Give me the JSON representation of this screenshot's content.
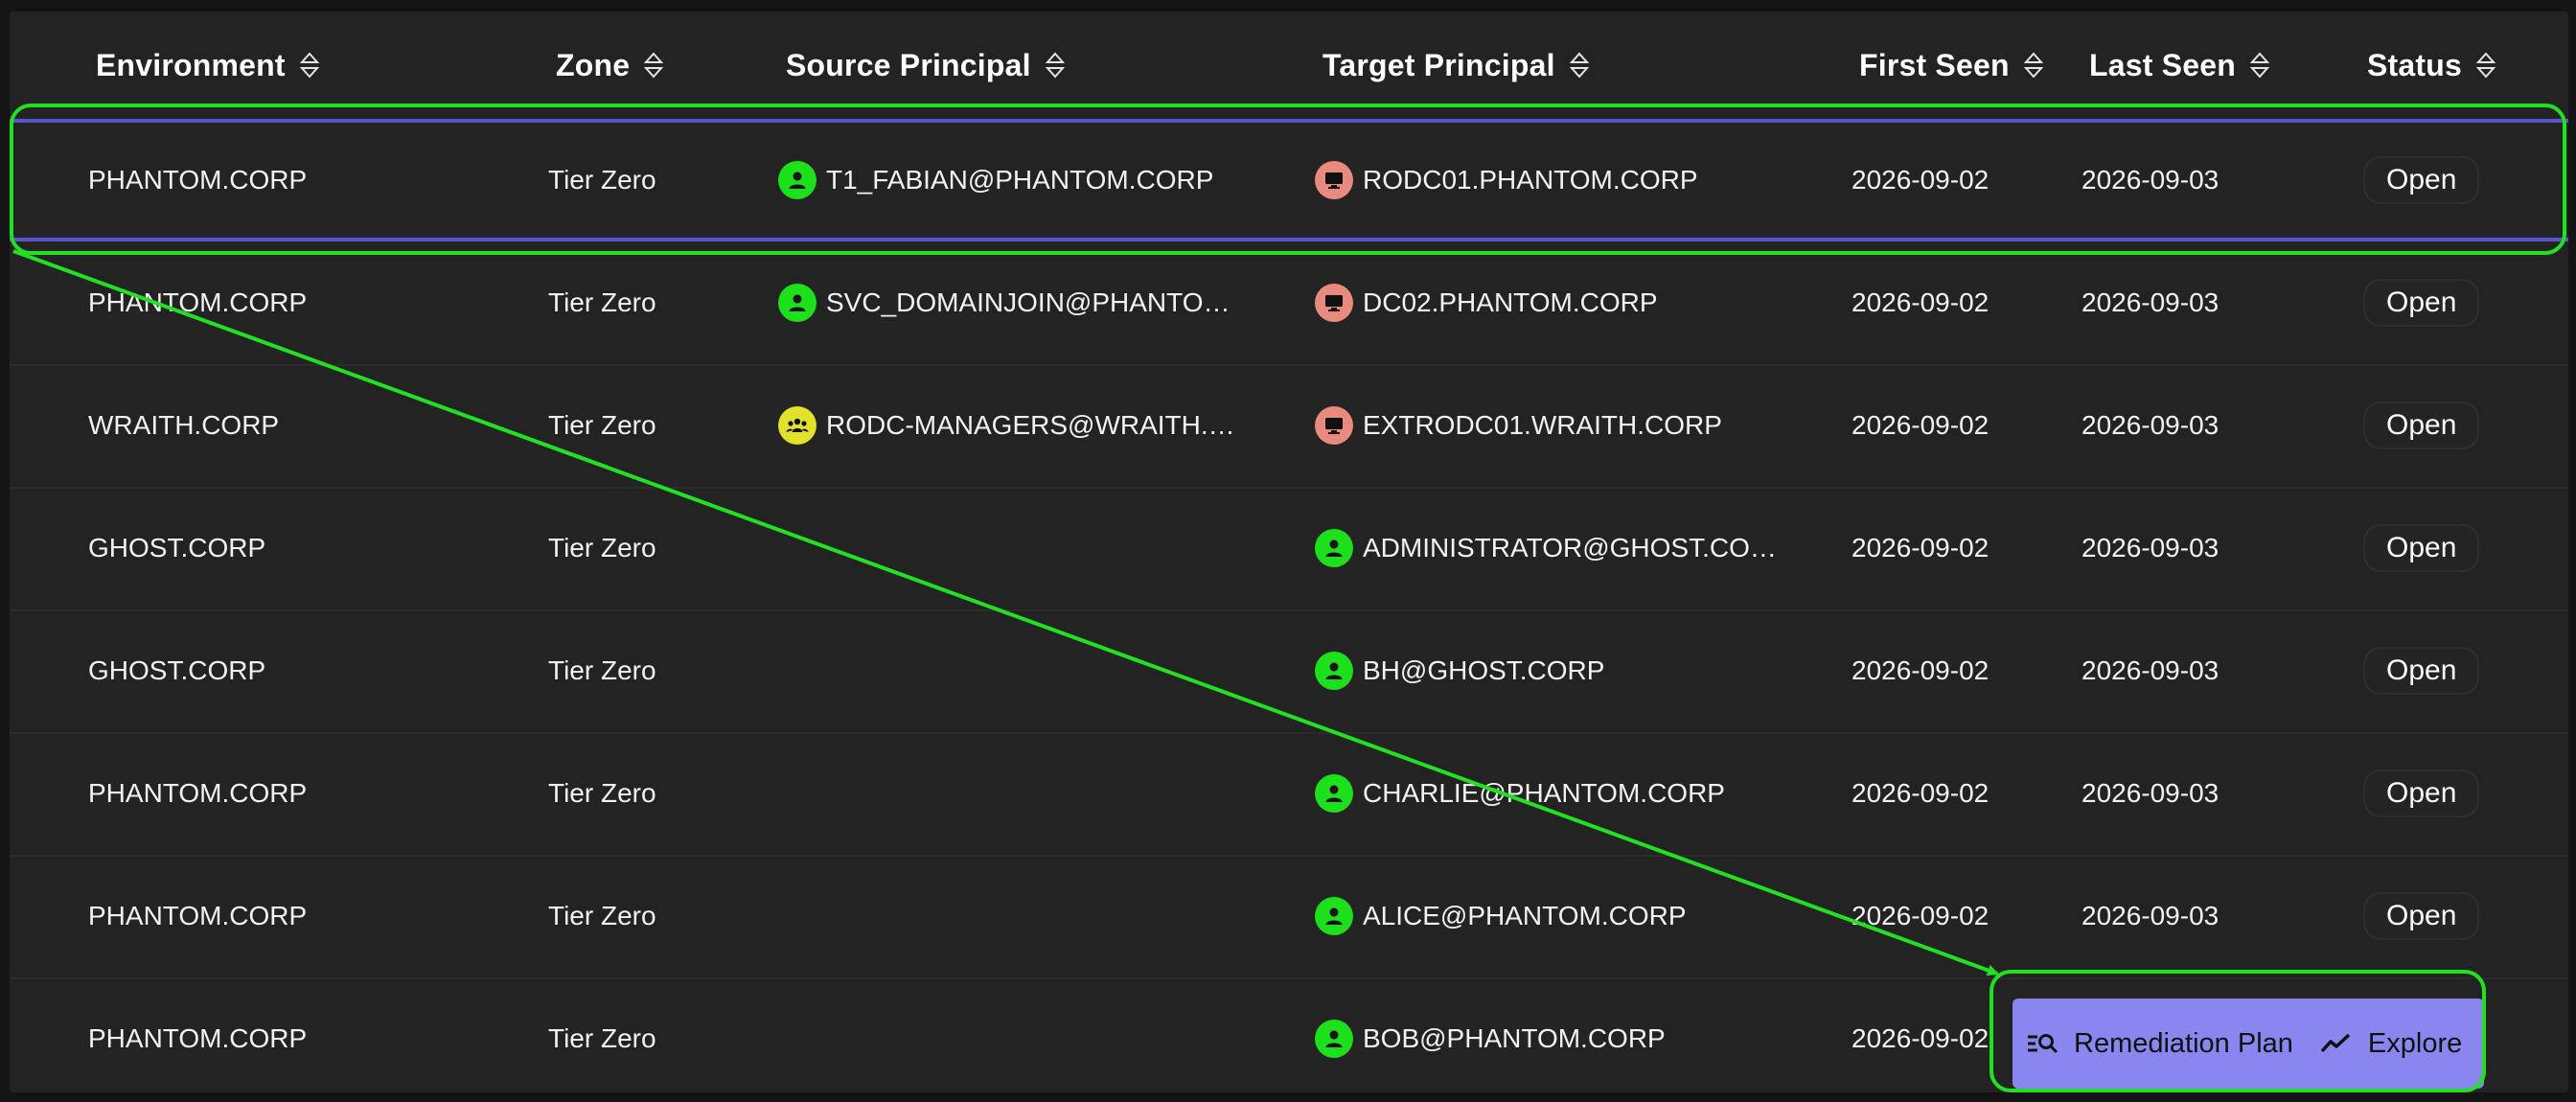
{
  "table": {
    "headers": [
      "Environment",
      "Zone",
      "Source Principal",
      "Target Principal",
      "First Seen",
      "Last Seen",
      "Status"
    ],
    "rows": [
      {
        "environment": "PHANTOM.CORP",
        "zone": "Tier Zero",
        "source": "T1_FABIAN@PHANTOM.CORP",
        "source_type": "user",
        "target": "RODC01.PHANTOM.CORP",
        "target_type": "computer",
        "first_seen": "2026-09-02",
        "last_seen": "2026-09-03",
        "status": "Open"
      },
      {
        "environment": "PHANTOM.CORP",
        "zone": "Tier Zero",
        "source": "SVC_DOMAINJOIN@PHANTOM....",
        "source_type": "user",
        "target": "DC02.PHANTOM.CORP",
        "target_type": "computer",
        "first_seen": "2026-09-02",
        "last_seen": "2026-09-03",
        "status": "Open"
      },
      {
        "environment": "WRAITH.CORP",
        "zone": "Tier Zero",
        "source": "RODC-MANAGERS@WRAITH.CO...",
        "source_type": "group",
        "target": "EXTRODC01.WRAITH.CORP",
        "target_type": "computer",
        "first_seen": "2026-09-02",
        "last_seen": "2026-09-03",
        "status": "Open"
      },
      {
        "environment": "GHOST.CORP",
        "zone": "Tier Zero",
        "source": "",
        "source_type": "",
        "target": "ADMINISTRATOR@GHOST.CORP",
        "target_type": "user",
        "first_seen": "2026-09-02",
        "last_seen": "2026-09-03",
        "status": "Open"
      },
      {
        "environment": "GHOST.CORP",
        "zone": "Tier Zero",
        "source": "",
        "source_type": "",
        "target": "BH@GHOST.CORP",
        "target_type": "user",
        "first_seen": "2026-09-02",
        "last_seen": "2026-09-03",
        "status": "Open"
      },
      {
        "environment": "PHANTOM.CORP",
        "zone": "Tier Zero",
        "source": "",
        "source_type": "",
        "target": "CHARLIE@PHANTOM.CORP",
        "target_type": "user",
        "first_seen": "2026-09-02",
        "last_seen": "2026-09-03",
        "status": "Open"
      },
      {
        "environment": "PHANTOM.CORP",
        "zone": "Tier Zero",
        "source": "",
        "source_type": "",
        "target": "ALICE@PHANTOM.CORP",
        "target_type": "user",
        "first_seen": "2026-09-02",
        "last_seen": "2026-09-03",
        "status": "Open"
      },
      {
        "environment": "PHANTOM.CORP",
        "zone": "Tier Zero",
        "source": "",
        "source_type": "",
        "target": "BOB@PHANTOM.CORP",
        "target_type": "user",
        "first_seen": "2026-09-02",
        "last_seen": "",
        "status": ""
      }
    ]
  },
  "actions": {
    "remediation_label": "Remediation Plan",
    "explore_label": "Explore"
  },
  "colors": {
    "panel": "#232323",
    "selected_border": "#5a54c9",
    "action_bar": "#8a86f0",
    "highlight": "#22e022",
    "user_icon": "#1de01d",
    "computer_icon": "#e98a7e",
    "group_icon": "#e2e22a"
  },
  "icons": {
    "sort": "sort-icon",
    "user": "user-icon",
    "computer": "computer-icon",
    "group": "group-icon",
    "remediation": "list-search-icon",
    "explore": "trend-line-icon"
  }
}
